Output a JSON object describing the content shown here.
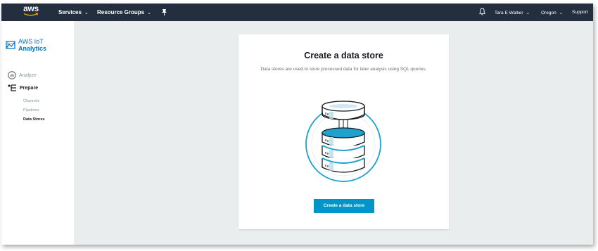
{
  "topnav": {
    "logo_text": "aws",
    "services_label": "Services",
    "resource_groups_label": "Resource Groups",
    "user_label": "Tara E Walker",
    "region_label": "Oregon",
    "support_label": "Support",
    "chevron": "⌄"
  },
  "sidebar": {
    "brand_line1": "AWS IoT",
    "brand_line2": "Analytics",
    "analyze_label": "Analyze",
    "prepare_label": "Prepare",
    "items": [
      {
        "label": "Channels"
      },
      {
        "label": "Pipelines"
      },
      {
        "label": "Data Stores"
      }
    ]
  },
  "card": {
    "title": "Create a data store",
    "description": "Data stores are used to store processed data for later analysis using SQL queries.",
    "button_label": "Create a data store"
  },
  "colors": {
    "nav_bg": "#232f3e",
    "accent": "#0095c8",
    "brand": "#0073bb",
    "page_bg": "#eaeded"
  },
  "icons": [
    "aws-smile-logo",
    "pin-icon",
    "bell-icon",
    "iot-analytics-icon",
    "analyze-icon",
    "prepare-icon",
    "data-store-illustration"
  ]
}
